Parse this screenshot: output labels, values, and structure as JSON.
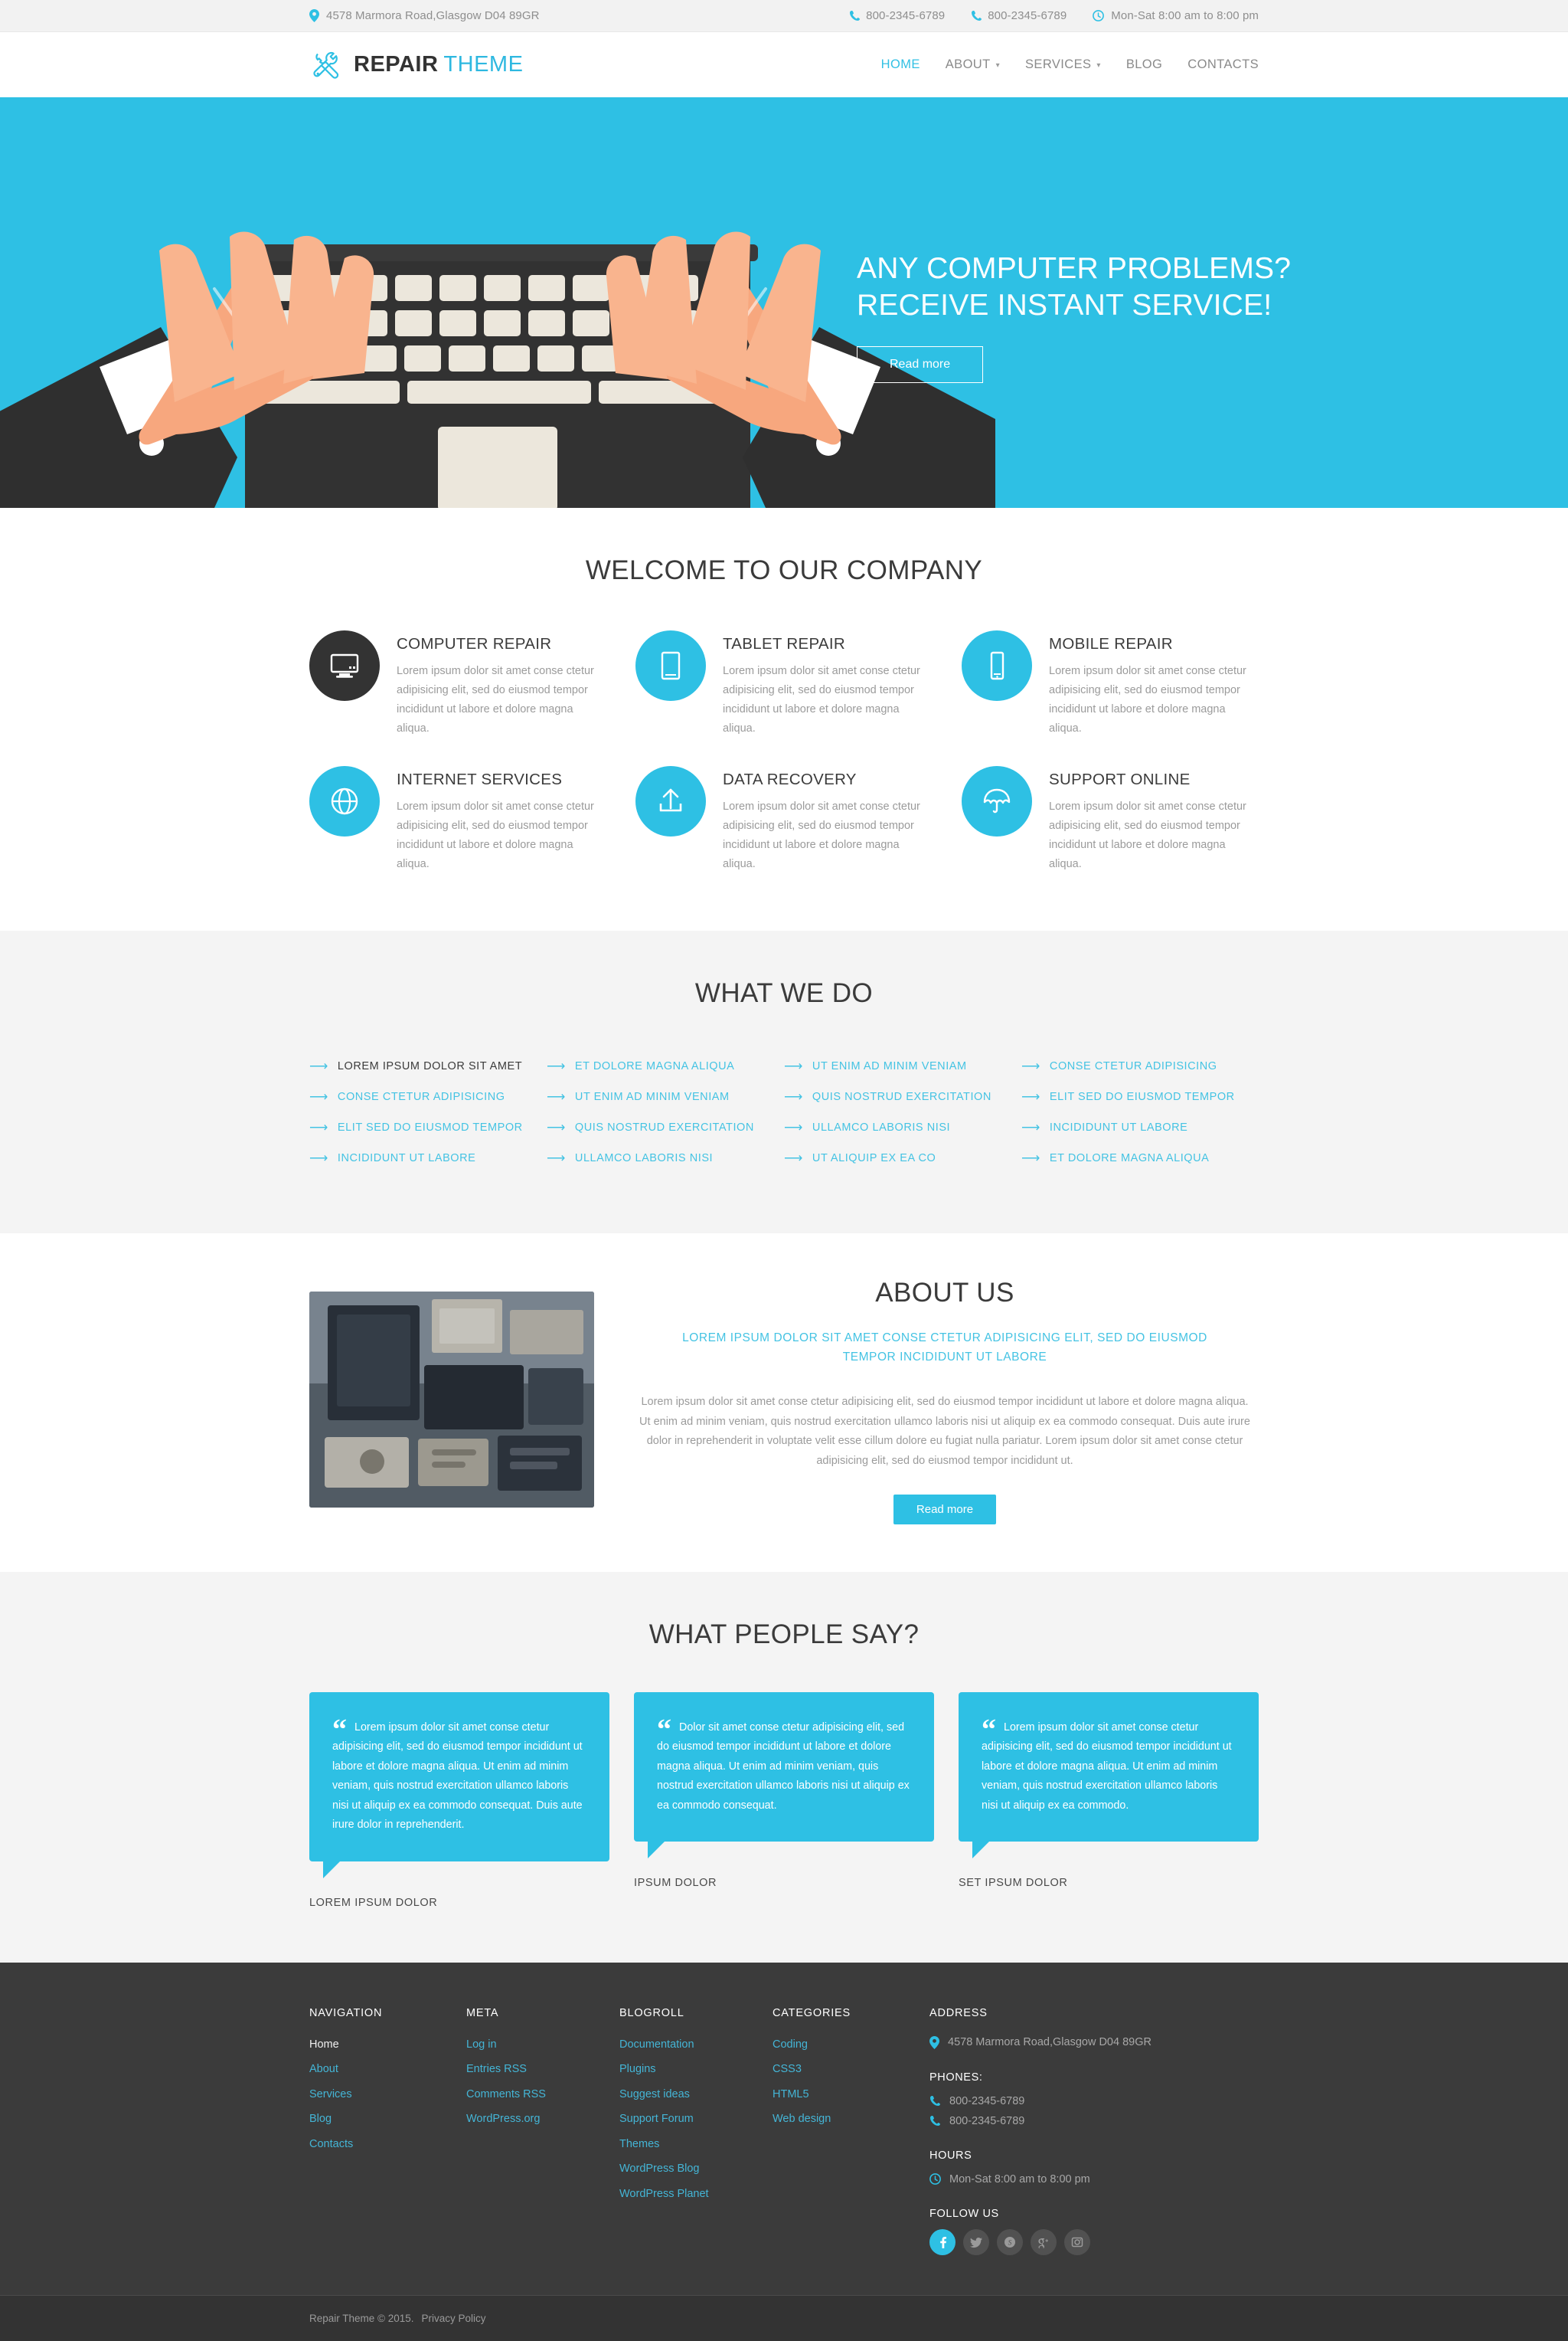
{
  "topbar": {
    "address": "4578 Marmora Road,Glasgow D04 89GR",
    "phone1": "800-2345-6789",
    "phone2": "800-2345-6789",
    "hours": "Mon-Sat 8:00 am to 8:00 pm"
  },
  "header": {
    "logo_word1": "REPAIR",
    "logo_word2": "THEME",
    "nav": [
      {
        "label": "HOME",
        "active": true,
        "dropdown": false
      },
      {
        "label": "ABOUT",
        "active": false,
        "dropdown": true
      },
      {
        "label": "SERVICES",
        "active": false,
        "dropdown": true
      },
      {
        "label": "BLOG",
        "active": false,
        "dropdown": false
      },
      {
        "label": "CONTACTS",
        "active": false,
        "dropdown": false
      }
    ]
  },
  "hero": {
    "line1": "ANY COMPUTER PROBLEMS?",
    "line2": "RECEIVE INSTANT SERVICE!",
    "button": "Read more"
  },
  "services": {
    "title": "WELCOME TO OUR COMPANY",
    "items": [
      {
        "title": "COMPUTER REPAIR",
        "text": "Lorem ipsum dolor sit amet conse ctetur adipisicing elit, sed do eiusmod tempor incididunt ut labore et dolore magna aliqua.",
        "icon": "monitor-icon",
        "dark": true
      },
      {
        "title": "TABLET REPAIR",
        "text": "Lorem ipsum dolor sit amet conse ctetur adipisicing elit, sed do eiusmod tempor incididunt ut labore et dolore magna aliqua.",
        "icon": "tablet-icon",
        "dark": false
      },
      {
        "title": "MOBILE REPAIR",
        "text": "Lorem ipsum dolor sit amet conse ctetur adipisicing elit, sed do eiusmod tempor incididunt ut labore et dolore magna aliqua.",
        "icon": "mobile-icon",
        "dark": false
      },
      {
        "title": "INTERNET SERVICES",
        "text": "Lorem ipsum dolor sit amet conse ctetur adipisicing elit, sed do eiusmod tempor incididunt ut labore et dolore magna aliqua.",
        "icon": "globe-icon",
        "dark": false
      },
      {
        "title": "DATA RECOVERY",
        "text": "Lorem ipsum dolor sit amet conse ctetur adipisicing elit, sed do eiusmod tempor incididunt ut labore et dolore magna aliqua.",
        "icon": "upload-icon",
        "dark": false
      },
      {
        "title": "SUPPORT ONLINE",
        "text": "Lorem ipsum dolor sit amet conse ctetur adipisicing elit, sed do eiusmod tempor incididunt ut labore et dolore magna aliqua.",
        "icon": "umbrella-icon",
        "dark": false
      }
    ]
  },
  "whatwedo": {
    "title": "WHAT WE DO",
    "columns": [
      [
        {
          "label": "LOREM IPSUM DOLOR SIT AMET",
          "dark": true
        },
        {
          "label": "CONSE CTETUR ADIPISICING",
          "dark": false
        },
        {
          "label": "ELIT SED DO EIUSMOD TEMPOR",
          "dark": false
        },
        {
          "label": "INCIDIDUNT UT LABORE",
          "dark": false
        }
      ],
      [
        {
          "label": "ET DOLORE MAGNA ALIQUA",
          "dark": false
        },
        {
          "label": "UT ENIM AD MINIM VENIAM",
          "dark": false
        },
        {
          "label": "QUIS NOSTRUD EXERCITATION",
          "dark": false
        },
        {
          "label": "ULLAMCO LABORIS NISI",
          "dark": false
        }
      ],
      [
        {
          "label": "UT ENIM AD MINIM VENIAM",
          "dark": false
        },
        {
          "label": "QUIS NOSTRUD EXERCITATION",
          "dark": false
        },
        {
          "label": "ULLAMCO LABORIS NISI",
          "dark": false
        },
        {
          "label": "UT ALIQUIP EX EA CO",
          "dark": false
        }
      ],
      [
        {
          "label": "CONSE CTETUR ADIPISICING",
          "dark": false
        },
        {
          "label": "ELIT SED DO EIUSMOD TEMPOR",
          "dark": false
        },
        {
          "label": "INCIDIDUNT UT LABORE",
          "dark": false
        },
        {
          "label": "ET DOLORE MAGNA ALIQUA",
          "dark": false
        }
      ]
    ]
  },
  "about": {
    "title": "ABOUT US",
    "subtitle": "LOREM IPSUM DOLOR SIT AMET CONSE CTETUR ADIPISICING ELIT, SED DO EIUSMOD TEMPOR INCIDIDUNT UT LABORE",
    "body": "Lorem ipsum dolor sit amet conse ctetur adipisicing elit, sed do eiusmod tempor incididunt ut labore et dolore magna aliqua. Ut enim ad minim veniam, quis nostrud exercitation ullamco laboris nisi ut aliquip ex ea commodo consequat. Duis aute irure dolor in reprehenderit in voluptate velit esse cillum dolore eu fugiat nulla pariatur. Lorem ipsum dolor sit amet conse ctetur adipisicing elit, sed do eiusmod tempor incididunt ut.",
    "button": "Read more",
    "image_alt": "workbench-with-computer-parts-photo"
  },
  "testimonials": {
    "title": "WHAT PEOPLE SAY?",
    "items": [
      {
        "text": "Lorem ipsum dolor sit amet conse ctetur adipisicing elit, sed do eiusmod tempor incididunt ut labore et dolore magna aliqua. Ut enim ad minim veniam, quis nostrud exercitation ullamco laboris nisi ut aliquip ex ea commodo consequat. Duis aute irure dolor in reprehenderit.",
        "author": "LOREM IPSUM DOLOR"
      },
      {
        "text": "Dolor sit amet conse ctetur adipisicing elit, sed do eiusmod tempor incididunt ut labore et dolore magna aliqua. Ut enim ad minim veniam, quis nostrud exercitation ullamco laboris nisi ut aliquip ex ea commodo consequat.",
        "author": "IPSUM DOLOR"
      },
      {
        "text": "Lorem ipsum dolor sit amet conse ctetur adipisicing elit, sed do eiusmod tempor incididunt ut labore et dolore magna aliqua. Ut enim ad minim veniam, quis nostrud exercitation ullamco laboris nisi ut aliquip ex ea commodo.",
        "author": "SET IPSUM DOLOR"
      }
    ]
  },
  "footer": {
    "navigation": {
      "title": "NAVIGATION",
      "links": [
        {
          "label": "Home",
          "plain": true
        },
        {
          "label": "About",
          "plain": false
        },
        {
          "label": "Services",
          "plain": false
        },
        {
          "label": "Blog",
          "plain": false
        },
        {
          "label": "Contacts",
          "plain": false
        }
      ]
    },
    "meta": {
      "title": "META",
      "links": [
        {
          "label": "Log in",
          "plain": false
        },
        {
          "label": "Entries RSS",
          "plain": false
        },
        {
          "label": "Comments RSS",
          "plain": false
        },
        {
          "label": "WordPress.org",
          "plain": false
        }
      ]
    },
    "blogroll": {
      "title": "BLOGROLL",
      "links": [
        {
          "label": "Documentation",
          "plain": false
        },
        {
          "label": "Plugins",
          "plain": false
        },
        {
          "label": "Suggest ideas",
          "plain": false
        },
        {
          "label": "Support Forum",
          "plain": false
        },
        {
          "label": "Themes",
          "plain": false
        },
        {
          "label": "WordPress Blog",
          "plain": false
        },
        {
          "label": "WordPress Planet",
          "plain": false
        }
      ]
    },
    "categories": {
      "title": "CATEGORIES",
      "links": [
        {
          "label": "Coding",
          "plain": false
        },
        {
          "label": "CSS3",
          "plain": false
        },
        {
          "label": "HTML5",
          "plain": false
        },
        {
          "label": "Web design",
          "plain": false
        }
      ]
    },
    "contacts": {
      "address_title": "ADDRESS",
      "address": "4578 Marmora Road,Glasgow D04 89GR",
      "phones_title": "PHONES:",
      "phone1": "800-2345-6789",
      "phone2": "800-2345-6789",
      "hours_title": "HOURS",
      "hours": "Mon-Sat 8:00 am to 8:00 pm",
      "follow_title": "FOLLOW US",
      "socials": [
        {
          "name": "facebook-icon",
          "glyph": "f",
          "active": true
        },
        {
          "name": "twitter-icon",
          "glyph": "t",
          "active": false
        },
        {
          "name": "skype-icon",
          "glyph": "S",
          "active": false
        },
        {
          "name": "google-plus-icon",
          "glyph": "g+",
          "active": false
        },
        {
          "name": "instagram-icon",
          "glyph": "i",
          "active": false
        }
      ]
    }
  },
  "copyright": {
    "text": "Repair Theme © 2015.",
    "privacy": "Privacy Policy"
  },
  "colors": {
    "accent": "#2ec0e4",
    "dark": "#3b3b3b",
    "light_bg": "#f4f4f4"
  }
}
